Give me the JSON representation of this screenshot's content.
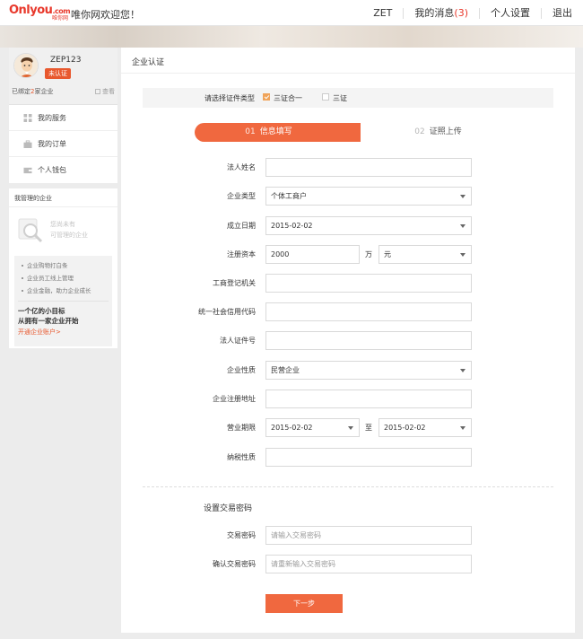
{
  "header": {
    "logo_text": "Onlyou",
    "logo_suffix": ".com",
    "logo_sub": "唯你网",
    "welcome": "唯你网欢迎您！",
    "nav": {
      "user": "ZET",
      "messages_label": "我的消息",
      "messages_count": "(3)",
      "settings": "个人设置",
      "logout": "退出"
    }
  },
  "sidebar": {
    "username": "ZEP123",
    "status_badge": "未认证",
    "bound_prefix": "已绑定",
    "bound_count": "2",
    "bound_suffix": "家企业",
    "view": "查看",
    "menu": [
      {
        "label": "我的服务",
        "icon": "grid-icon"
      },
      {
        "label": "我的订单",
        "icon": "briefcase-icon"
      },
      {
        "label": "个人钱包",
        "icon": "wallet-icon"
      }
    ],
    "managed": {
      "title": "我管理的企业",
      "empty_line1": "您尚未有",
      "empty_line2": "可管理的企业",
      "benefits": [
        "企业购物打白条",
        "企业员工线上管理",
        "企业金融，助力企业成长"
      ],
      "goal_line1": "一个亿的小目标",
      "goal_line2": "从拥有一家企业开始",
      "open_link": "开通企业账户>"
    }
  },
  "main": {
    "title": "企业认证",
    "id_type": {
      "label": "请选择证件类型",
      "option1": "三证合一",
      "option1_checked": true,
      "option2": "三证",
      "option2_checked": false
    },
    "steps": {
      "step1_num": "01",
      "step1_label": "信息填写",
      "step2_num": "02",
      "step2_label": "证照上传"
    },
    "form": {
      "legal_name_label": "法人姓名",
      "legal_name_value": "",
      "company_type_label": "企业类型",
      "company_type_value": "个体工商户",
      "established_label": "成立日期",
      "established_value": "2015-02-02",
      "capital_label": "注册资本",
      "capital_value": "2000",
      "capital_unit": "万",
      "currency_value": "元",
      "registry_authority_label": "工商登记机关",
      "registry_authority_value": "",
      "credit_code_label": "统一社会信用代码",
      "credit_code_value": "",
      "legal_id_label": "法人证件号",
      "legal_id_value": "",
      "nature_label": "企业性质",
      "nature_value": "民营企业",
      "address_label": "企业注册地址",
      "address_value": "",
      "term_label": "营业期限",
      "term_start": "2015-02-02",
      "term_separator": "至",
      "term_end": "2015-02-02",
      "tax_label": "纳税性质",
      "tax_value": ""
    },
    "password_section": {
      "title": "设置交易密码",
      "password_label": "交易密码",
      "password_placeholder": "请输入交易密码",
      "confirm_label": "确认交易密码",
      "confirm_placeholder": "请重新输入交易密码"
    },
    "next_button": "下一步"
  },
  "colors": {
    "accent": "#f0683f",
    "brand_red": "#e8382b",
    "checkbox_orange": "#f0a45a"
  }
}
